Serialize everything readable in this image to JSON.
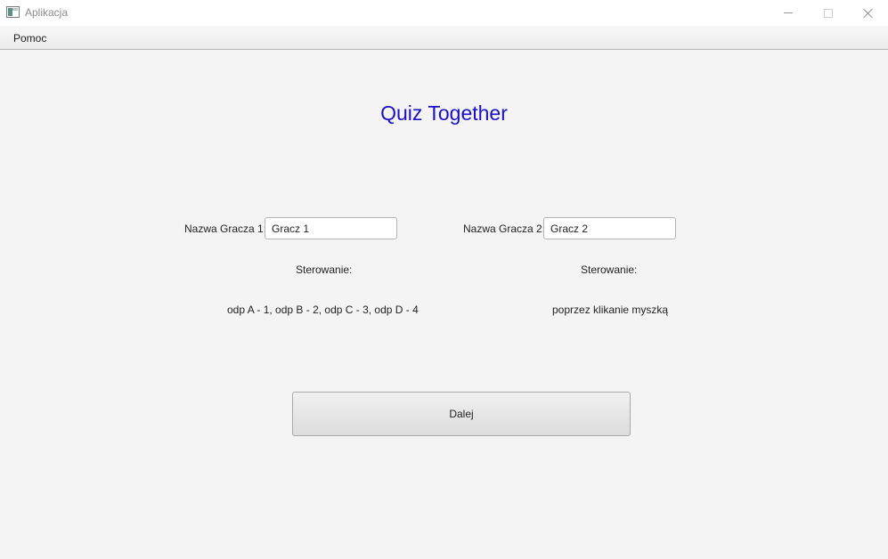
{
  "window": {
    "title": "Aplikacja",
    "controls": [
      "minimize-icon",
      "maximize-icon",
      "close-icon"
    ]
  },
  "menubar": {
    "items": [
      {
        "label": "Pomoc"
      }
    ]
  },
  "main": {
    "title": "Quiz Together",
    "title_color": "#1b0fc8",
    "player1": {
      "label": "Nazwa Gracza 1:",
      "value": "Gracz 1",
      "controls_label": "Sterowanie:",
      "controls_text": "odp A - 1, odp B - 2, odp C - 3, odp D - 4"
    },
    "player2": {
      "label": "Nazwa Gracza 2:",
      "value": "Gracz 2",
      "controls_label": "Sterowanie:",
      "controls_text": "poprzez klikanie myszką"
    },
    "next_button_label": "Dalej"
  }
}
